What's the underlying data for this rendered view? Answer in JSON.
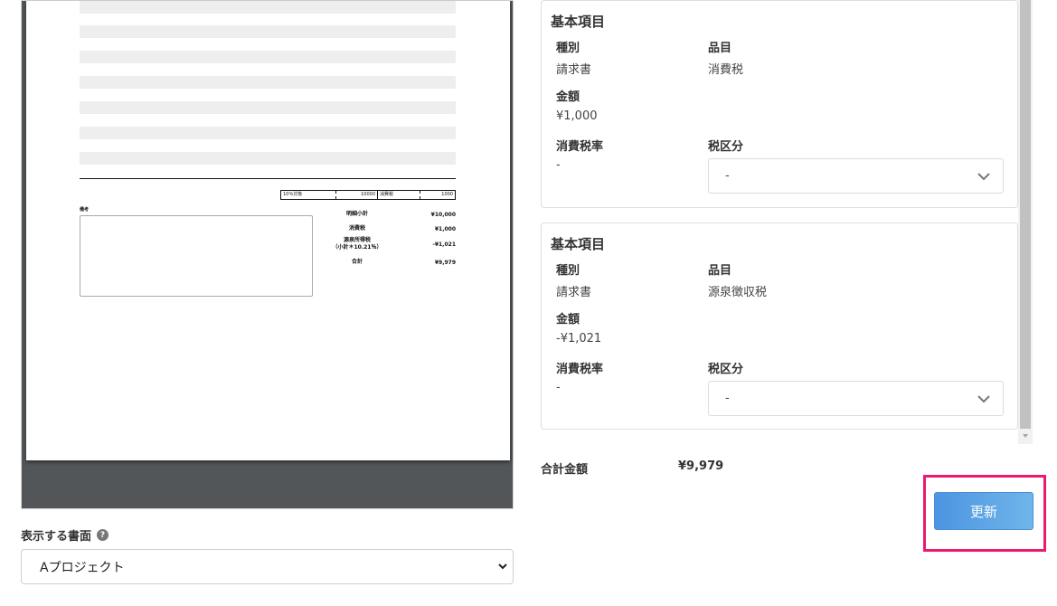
{
  "preview": {
    "tax_table": {
      "rate_label": "10％対象",
      "base": "10000",
      "tax_label": "消費税",
      "tax": "1000"
    },
    "memo_label": "備考",
    "summary": {
      "subtotal_label": "明細小計",
      "subtotal": "¥10,000",
      "consumption_tax_label": "消費税",
      "consumption_tax": "¥1,000",
      "withholding_label_1": "源泉所得税",
      "withholding_label_2": "（小計＊10.21％）",
      "withholding": "-¥1,021",
      "total_label": "合計",
      "total": "¥9,979"
    }
  },
  "display_doc": {
    "label": "表示する書面",
    "help_icon": "question-circle-icon",
    "selected": "Aプロジェクト"
  },
  "cards": [
    {
      "title": "基本項目",
      "type_label": "種別",
      "type_value": "請求書",
      "item_label": "品目",
      "item_value": "消費税",
      "amount_label": "金額",
      "amount_value": "¥1,000",
      "rate_label": "消費税率",
      "rate_value": "-",
      "category_label": "税区分",
      "category_value": "-"
    },
    {
      "title": "基本項目",
      "type_label": "種別",
      "type_value": "請求書",
      "item_label": "品目",
      "item_value": "源泉徴収税",
      "amount_label": "金額",
      "amount_value": "-¥1,021",
      "rate_label": "消費税率",
      "rate_value": "-",
      "category_label": "税区分",
      "category_value": "-"
    }
  ],
  "total": {
    "label": "合計金額",
    "value": "¥9,979"
  },
  "update_button": {
    "label": "更新"
  },
  "colors": {
    "accent_blue": "#4d94e2",
    "highlight_pink": "#ea1a6f",
    "preview_bg": "#525659"
  }
}
